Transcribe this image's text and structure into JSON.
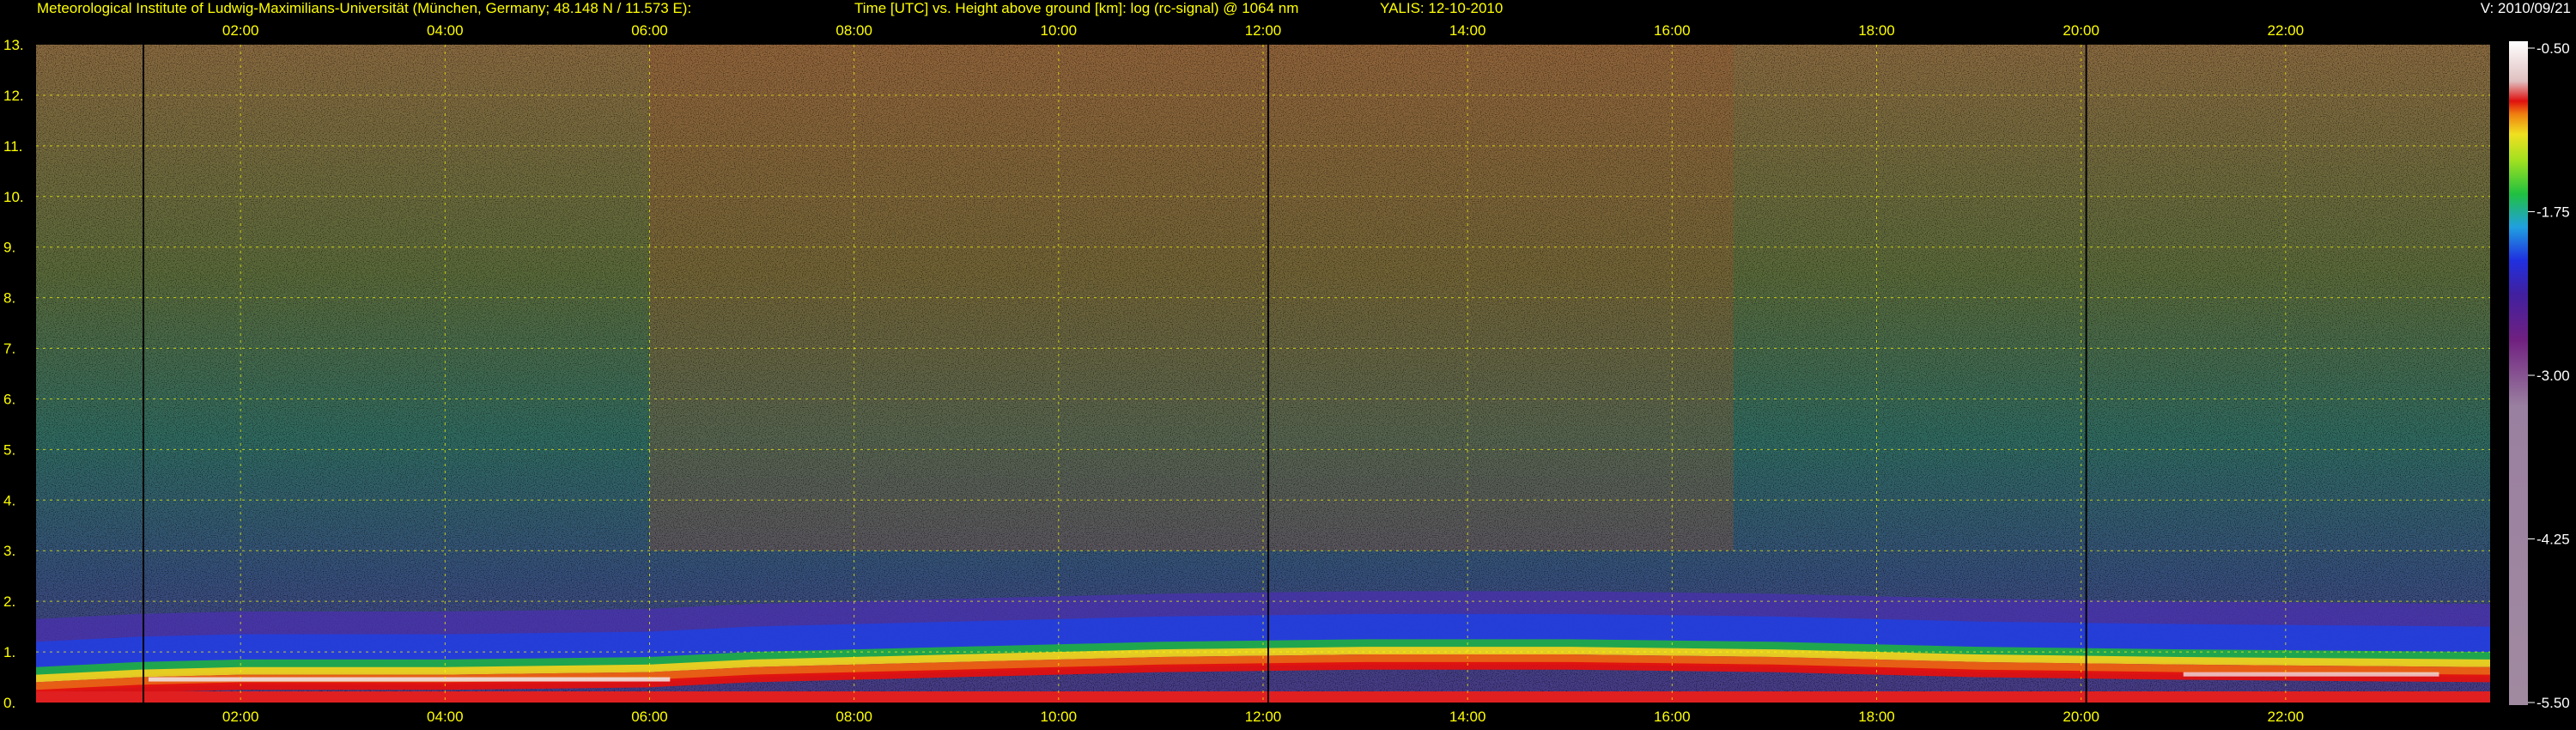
{
  "header": {
    "institute": "Meteorological Institute of Ludwig-Maximilians-Universität (München, Germany; 48.148 N / 11.573 E):",
    "plot_description": "Time [UTC] vs. Height above ground [km]: log (rc-signal) @ 1064 nm",
    "instrument_date": "YALIS: 12-10-2010",
    "version": "V: 2010/09/21"
  },
  "chart_data": {
    "type": "heatmap",
    "x_axis": {
      "range_hours": [
        0,
        24
      ],
      "ticks": [
        "02:00",
        "04:00",
        "06:00",
        "08:00",
        "10:00",
        "12:00",
        "14:00",
        "16:00",
        "18:00",
        "20:00",
        "22:00"
      ]
    },
    "y_axis": {
      "range_km": [
        0,
        13
      ],
      "ticks": [
        "0.",
        "1.",
        "2.",
        "3.",
        "4.",
        "5.",
        "6.",
        "7.",
        "8.",
        "9.",
        "10.",
        "11.",
        "12.",
        "13."
      ]
    },
    "colorbar": {
      "range": [
        -5.5,
        -0.5
      ],
      "tick_labels": [
        "-0.50",
        "-1.75",
        "-3.00",
        "-4.25",
        "-5.50"
      ],
      "tick_values": [
        -0.5,
        -1.75,
        -3.0,
        -4.25,
        -5.5
      ]
    },
    "grid": true,
    "features": {
      "boundary_layer_top_km": [
        [
          0.0,
          0.45
        ],
        [
          1.0,
          0.55
        ],
        [
          2.0,
          0.6
        ],
        [
          4.0,
          0.6
        ],
        [
          6.0,
          0.65
        ],
        [
          7.0,
          0.75
        ],
        [
          9.0,
          0.85
        ],
        [
          11.0,
          0.95
        ],
        [
          13.0,
          1.0
        ],
        [
          15.0,
          1.0
        ],
        [
          17.0,
          0.95
        ],
        [
          19.0,
          0.85
        ],
        [
          21.0,
          0.8
        ],
        [
          24.0,
          0.75
        ]
      ],
      "data_gaps_hours": [
        1.05,
        12.05,
        20.05
      ]
    }
  }
}
